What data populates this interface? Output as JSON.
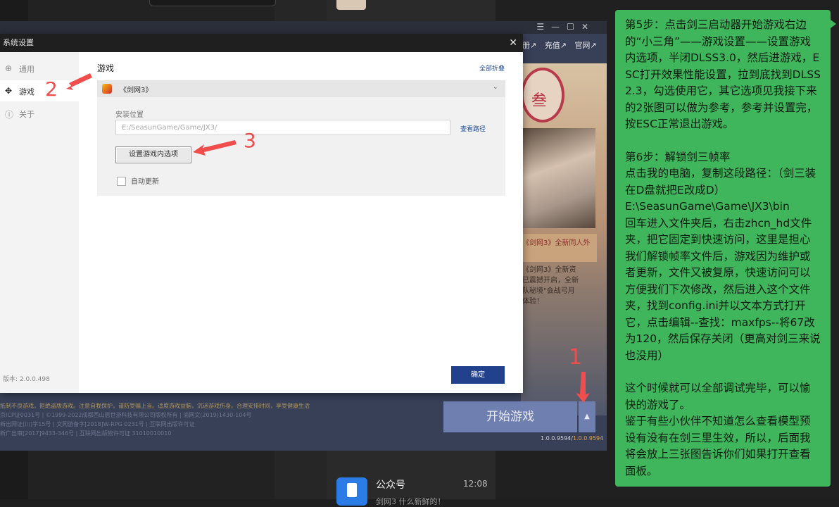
{
  "background": {
    "chat_item": {
      "name": "公众号",
      "time": "12:08",
      "preview": "剑网3 什么新鲜的！"
    }
  },
  "launcher": {
    "links": [
      "册↗",
      "充值↗",
      "官网↗"
    ],
    "window_controls": [
      "☰",
      "—",
      "☐",
      "✕"
    ],
    "seal_text": "叁",
    "art_caption": "《剑网3》全新同人外",
    "art_news": [
      "《剑网3》全新资",
      "已震撼开启，全新",
      "队秘境\"会战弓月",
      "体验！"
    ],
    "footer_lines": [
      "抵制不良游戏，拒绝盗版游戏。注意自我保护，谨防受骗上当。适度游戏益脑，沉迷游戏伤身。合理安排时间，享受健康生活",
      "京ICP证0031号 | ©1999-2022成都西山居世游科技有限公司版权所有 | 渝网文(2019)1430-104号",
      "新出网证(川)字15号 | 文网游备字[2018]W-RPG 0231号 | 互联网出版许可证",
      "新广出审[2017]9433-346号 | 互联网出版物许可证 31010010010"
    ],
    "start_button": "开始游戏",
    "start_dropdown_icon": "▲",
    "version_prefix": "1.0.0.9594/",
    "version_highlight": "1.0.0.9594"
  },
  "dialog": {
    "title": "系统设置",
    "close_icon": "✕",
    "sidebar": [
      {
        "icon": "globe-icon",
        "glyph": "⊕",
        "label": "通用"
      },
      {
        "icon": "gamepad-icon",
        "glyph": "✥",
        "label": "游戏"
      },
      {
        "icon": "info-icon",
        "glyph": "ⓘ",
        "label": "关于"
      }
    ],
    "version": "版本: 2.0.0.498",
    "section_title": "游戏",
    "collapse_all": "全部折叠",
    "game_name": "《剑网3》",
    "chevron": "⌄",
    "install_label": "安装位置",
    "install_path": "E:/SeasunGame/Game/JX3/",
    "view_path": "查看路径",
    "ingame_options_button": "设置游戏内选项",
    "auto_update_label": "自动更新",
    "auto_update_checked": false,
    "ok_button": "确定"
  },
  "annotations": {
    "num1": "1",
    "num2": "2",
    "num3": "3",
    "color": "#f14d4d"
  },
  "bubble": {
    "step5": "第5步：点击剑三启动器开始游戏右边的“小三角”——游戏设置——设置游戏内选项，半闭DLSS3.0，然后进游戏，ESC打开效果性能设置，拉到底找到DLSS2.3，勾选使用它，其它选项见我接下来的2张图可以做为参考，参考并设置完，按ESC正常退出游戏。",
    "step6_title": "第6步：解锁剑三帧率",
    "step6_body": "点击我的电脑，复制这段路径：（剑三装在D盘就把E改成D）",
    "step6_path": "E:\\SeasunGame\\Game\\JX3\\bin",
    "step6_rest": "回车进入文件夹后，右击zhcn_hd文件夹，把它固定到快速访问，这里是担心我们解锁帧率文件后，游戏因为维护或者更新，文件又被复原，快速访问可以方便我们下次修改，然后进入这个文件夹，找到config.ini并以文本方式打开它，点击编辑--查找：maxfps--将67改为120，然后保存关闭（更高对剑三来说也没用）",
    "done": "这个时候就可以全部调试完毕，可以愉快的游戏了。",
    "closing": "鉴于有些小伙伴不知道怎么查看模型预设有没有在剑三里生效，所以，后面我将会放上三张图告诉你们如果打开查看面板。",
    "color": "#3fb65c"
  }
}
